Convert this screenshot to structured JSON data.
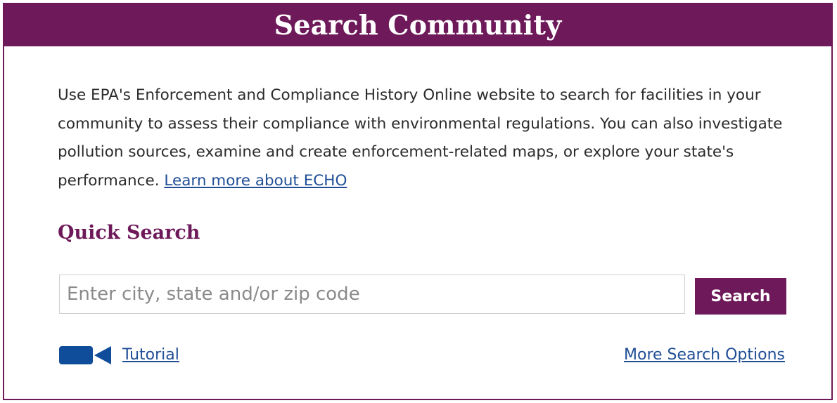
{
  "header": {
    "title": "Search Community"
  },
  "description": {
    "text": "Use EPA's Enforcement and Compliance History Online website to search for facilities in your community to assess their compliance with environmental regulations. You can also investigate pollution sources, examine and create enforcement-related maps, or explore your state's performance. ",
    "link_label": "Learn more about ECHO"
  },
  "quick_search": {
    "title": "Quick Search",
    "input_value": "",
    "placeholder": "Enter city, state and/or zip code",
    "button_label": "Search"
  },
  "footer_links": {
    "tutorial_label": "Tutorial",
    "tutorial_icon": "video-camera-icon",
    "more_options_label": "More Search Options"
  },
  "colors": {
    "brand_purple": "#6e1a5a",
    "link_blue": "#1f4e96",
    "icon_blue": "#0f4c9a"
  }
}
